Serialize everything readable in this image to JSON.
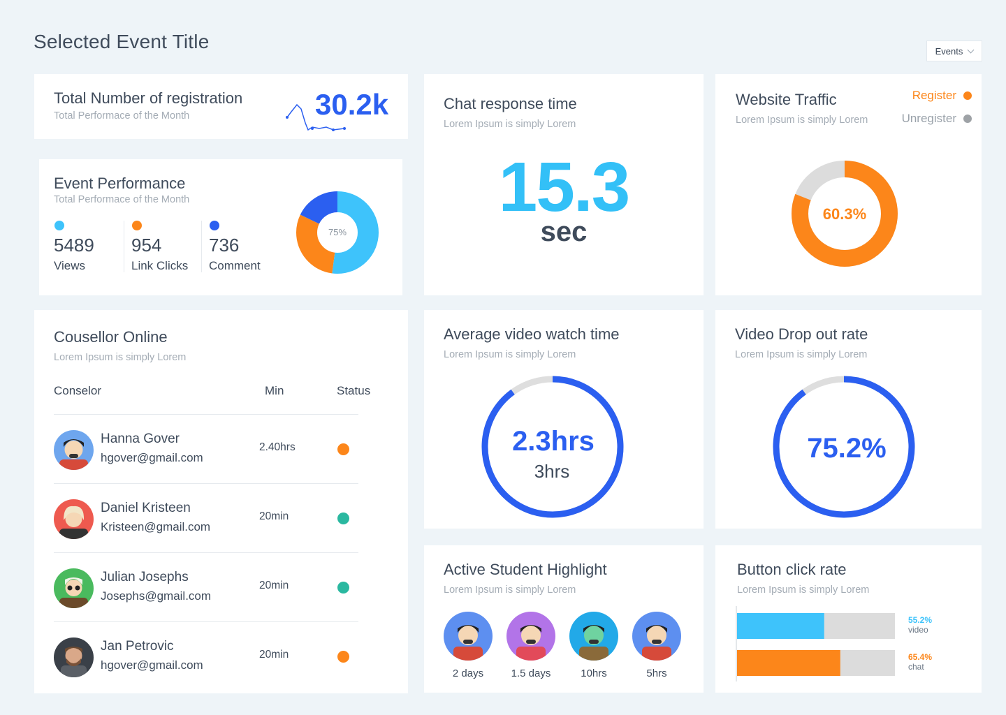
{
  "page_title": "Selected Event Title",
  "events_select": {
    "value": "Events"
  },
  "registration": {
    "title": "Total Number of registration",
    "subtitle": "Total Performace of the Month",
    "value": "30.2k"
  },
  "event_performance": {
    "title": "Event Performance",
    "subtitle": "Total Performace of the Month",
    "stats": [
      {
        "value": "5489",
        "label": "Views",
        "color": "#3ec3fb"
      },
      {
        "value": "954",
        "label": "Link Clicks",
        "color": "#fc861a"
      },
      {
        "value": "736",
        "label": "Comment",
        "color": "#2b5ff0"
      }
    ],
    "donut_center": "75%",
    "donut_segments": [
      {
        "name": "Views",
        "percent": 52,
        "color": "#3ec3fb"
      },
      {
        "name": "Link Clicks",
        "percent": 30,
        "color": "#fc861a"
      },
      {
        "name": "Comment",
        "percent": 18,
        "color": "#2b5ff0"
      }
    ]
  },
  "chat_response": {
    "title": "Chat response time",
    "subtitle": "Lorem Ipsum is simply Lorem",
    "value": "15.3",
    "unit": "sec"
  },
  "website_traffic": {
    "title": "Website Traffic",
    "subtitle": "Lorem Ipsum is simply Lorem",
    "legend": [
      {
        "label": "Register",
        "color": "#fc861a"
      },
      {
        "label": "Unregister",
        "color": "#9ea2a6"
      }
    ],
    "center": "60.3%",
    "register_fraction": 0.81
  },
  "counsellor": {
    "title": "Cousellor Online",
    "subtitle": "Lorem Ipsum is simply Lorem",
    "headers": {
      "name": "Conselor",
      "min": "Min",
      "status": "Status"
    },
    "rows": [
      {
        "name": "Hanna Gover",
        "email": "hgover@gmail.com",
        "min": "2.40hrs",
        "status_color": "#fc861a",
        "avatar_bg": "#6ea6ee"
      },
      {
        "name": "Daniel Kristeen",
        "email": "Kristeen@gmail.com",
        "min": "20min",
        "status_color": "#2ab8a0",
        "avatar_bg": "#ee5a4f"
      },
      {
        "name": "Julian Josephs",
        "email": "Josephs@gmail.com",
        "min": "20min",
        "status_color": "#2ab8a0",
        "avatar_bg": "#4aba5e"
      },
      {
        "name": "Jan Petrovic",
        "email": "hgover@gmail.com",
        "min": "20min",
        "status_color": "#fc861a",
        "avatar_bg": "#3a4048"
      }
    ]
  },
  "avg_video": {
    "title": "Average video watch time",
    "subtitle": "Lorem Ipsum is simply Lorem",
    "value": "2.3hrs",
    "total": "3hrs",
    "fraction": 0.9
  },
  "video_drop": {
    "title": "Video Drop out rate",
    "subtitle": "Lorem Ipsum is simply Lorem",
    "value": "75.2%",
    "fraction": 0.9
  },
  "active_students": {
    "title": "Active Student Highlight",
    "subtitle": "Lorem Ipsum is simply Lorem",
    "students": [
      {
        "label": "2 days",
        "bg": "#5d8ff0"
      },
      {
        "label": "1.5 days",
        "bg": "#b274e8"
      },
      {
        "label": "10hrs",
        "bg": "#22a9e8"
      },
      {
        "label": "5hrs",
        "bg": "#5d8ff0"
      }
    ]
  },
  "button_click": {
    "title": "Button click rate",
    "subtitle": "Lorem Ipsum is simply Lorem",
    "chart_data": {
      "type": "bar",
      "categories": [
        "video",
        "chat"
      ],
      "values": [
        55.2,
        65.4
      ],
      "labels": [
        "55.2%",
        "65.4%"
      ],
      "colors": [
        "#3ec3fb",
        "#fc861a"
      ],
      "ylim": [
        0,
        100
      ]
    }
  }
}
